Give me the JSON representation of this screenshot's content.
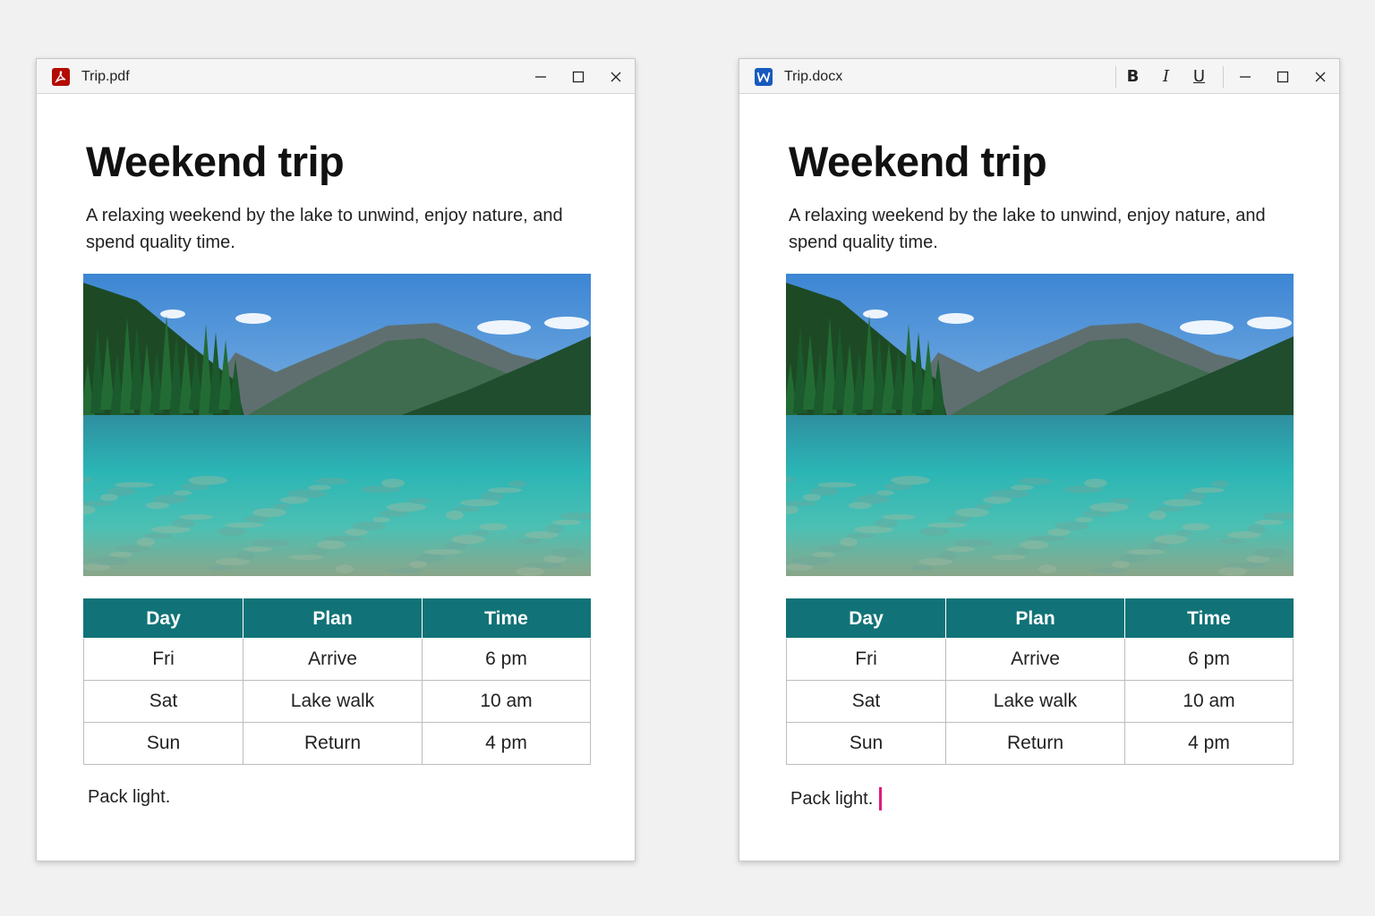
{
  "windows": [
    {
      "id": "pdf",
      "file_name": "Trip.pdf",
      "app_icon": "pdf-icon",
      "icon_color": "#b30b00"
    },
    {
      "id": "docx",
      "file_name": "Trip.docx",
      "app_icon": "word-icon",
      "icon_color": "#185abd",
      "toolbar": {
        "bold": "B",
        "italic": "I",
        "underline": "U"
      }
    }
  ],
  "document": {
    "title": "Weekend trip",
    "description": "A relaxing weekend by the lake to unwind, enjoy nature, and spend quality time.",
    "image": "lake-mountain-photo",
    "table": {
      "headers": [
        "Day",
        "Plan",
        "Time"
      ],
      "rows": [
        [
          "Fri",
          "Arrive",
          "6 pm"
        ],
        [
          "Sat",
          "Lake walk",
          "10 am"
        ],
        [
          "Sun",
          "Return",
          "4 pm"
        ]
      ],
      "header_color": "#117377"
    },
    "footer_note": "Pack light."
  },
  "cursor_color": "#e0197d"
}
